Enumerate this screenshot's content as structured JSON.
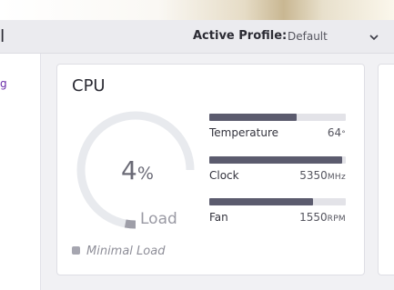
{
  "header": {
    "left_text": "l",
    "profile_label": "Active Profile:",
    "profile_value": "Default",
    "dropdown_icon": "chevron-down-icon"
  },
  "sidebar": {
    "accent_text": "g",
    "accent_color": "#6a2ca8"
  },
  "cpu_card": {
    "title": "CPU",
    "gauge": {
      "value": "4",
      "unit": "%",
      "caption": "Load",
      "fraction": 0.04
    },
    "status": {
      "text": "Minimal Load",
      "icon": "status-square-icon"
    },
    "metrics": [
      {
        "label": "Temperature",
        "value": "64",
        "unit": "°",
        "fraction": 0.64
      },
      {
        "label": "Clock",
        "value": "5350",
        "unit": "MHz",
        "fraction": 0.97
      },
      {
        "label": "Fan",
        "value": "1550",
        "unit": "RPM",
        "fraction": 0.76
      }
    ]
  },
  "colors": {
    "bar_fill": "#5b5b6e",
    "bar_track": "#e3e3e8",
    "gauge_track": "#e8eaee",
    "gauge_fill": "#9e9ea8"
  }
}
